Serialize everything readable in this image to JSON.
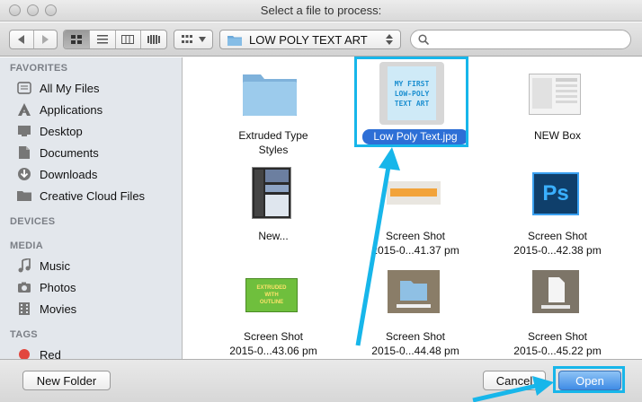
{
  "window": {
    "title": "Select a file to process:"
  },
  "toolbar": {
    "location": "LOW POLY TEXT ART",
    "search_placeholder": ""
  },
  "sidebar": {
    "favorites_header": "FAVORITES",
    "favorites": [
      {
        "label": "All My Files",
        "icon": "all-files-icon"
      },
      {
        "label": "Applications",
        "icon": "applications-icon"
      },
      {
        "label": "Desktop",
        "icon": "desktop-icon"
      },
      {
        "label": "Documents",
        "icon": "documents-icon"
      },
      {
        "label": "Downloads",
        "icon": "downloads-icon"
      },
      {
        "label": "Creative Cloud Files",
        "icon": "folder-icon"
      }
    ],
    "devices_header": "DEVICES",
    "media_header": "MEDIA",
    "media": [
      {
        "label": "Music",
        "icon": "music-icon"
      },
      {
        "label": "Photos",
        "icon": "photos-icon"
      },
      {
        "label": "Movies",
        "icon": "movies-icon"
      }
    ],
    "tags_header": "TAGS",
    "tags": [
      {
        "label": "Red",
        "color": "#e2473e"
      }
    ]
  },
  "files": [
    {
      "line1": "Extruded Type",
      "line2": "Styles",
      "kind": "folder"
    },
    {
      "line1": "Low Poly Text.jpg",
      "line2": "",
      "kind": "image",
      "selected": true,
      "thumb_text": [
        "MY FIRST",
        "LOW-POLY",
        "TEXT ART"
      ]
    },
    {
      "line1": "NEW Box",
      "line2": "",
      "kind": "image"
    },
    {
      "line1": "New...",
      "line2": "",
      "kind": "image"
    },
    {
      "line1": "Screen Shot",
      "line2": "2015-0...41.37 pm",
      "kind": "image"
    },
    {
      "line1": "Screen Shot",
      "line2": "2015-0...42.38 pm",
      "kind": "image",
      "thumb_text": [
        "Ps"
      ]
    },
    {
      "line1": "Screen Shot",
      "line2": "2015-0...43.06 pm",
      "kind": "image",
      "thumb_text": [
        "EXTRUDED",
        "WITH",
        "OUTLINE"
      ]
    },
    {
      "line1": "Screen Shot",
      "line2": "2015-0...44.48 pm",
      "kind": "image"
    },
    {
      "line1": "Screen Shot",
      "line2": "2015-0...45.22 pm",
      "kind": "image"
    }
  ],
  "buttons": {
    "new_folder": "New Folder",
    "cancel": "Cancel",
    "open": "Open"
  },
  "colors": {
    "selection": "#2d6fd6",
    "annotation": "#17b6ea",
    "ps_blue": "#0f3f6b"
  }
}
